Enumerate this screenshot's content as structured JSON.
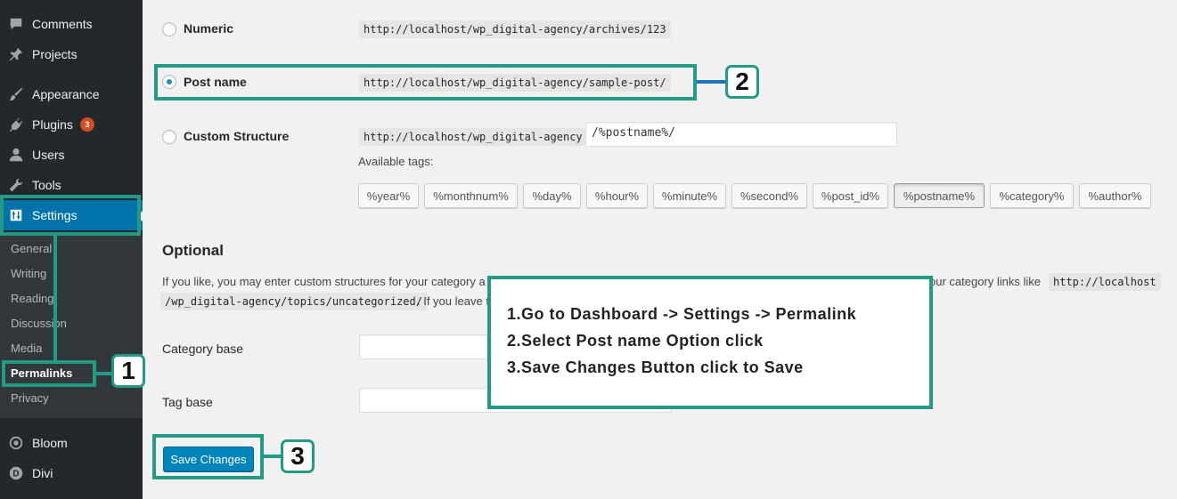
{
  "sidebar": {
    "menu": [
      {
        "label": "Comments",
        "icon": "comment-icon"
      },
      {
        "label": "Projects",
        "icon": "pin-icon"
      },
      {
        "label": "Appearance",
        "icon": "brush-icon"
      },
      {
        "label": "Plugins",
        "icon": "plugin-icon",
        "badge": "3"
      },
      {
        "label": "Users",
        "icon": "user-icon"
      },
      {
        "label": "Tools",
        "icon": "wrench-icon"
      },
      {
        "label": "Settings",
        "icon": "settings-icon"
      },
      {
        "label": "Bloom",
        "icon": "bloom-icon"
      },
      {
        "label": "Divi",
        "icon": "divi-icon"
      }
    ],
    "submenu": [
      "General",
      "Writing",
      "Reading",
      "Discussion",
      "Media",
      "Permalinks",
      "Privacy"
    ]
  },
  "permalink_options": {
    "numeric": {
      "label": "Numeric",
      "example": "http://localhost/wp_digital-agency/archives/123"
    },
    "post_name": {
      "label": "Post name",
      "example": "http://localhost/wp_digital-agency/sample-post/"
    },
    "custom": {
      "label": "Custom Structure",
      "prefix": "http://localhost/wp_digital-agency",
      "value": "/%postname%/"
    }
  },
  "available_tags_label": "Available tags:",
  "tags": [
    "%year%",
    "%monthnum%",
    "%day%",
    "%hour%",
    "%minute%",
    "%second%",
    "%post_id%",
    "%postname%",
    "%category%",
    "%author%"
  ],
  "optional": {
    "heading": "Optional",
    "line1_start": "If you like, you may enter custom structures for your category a",
    "line1_end": "our category links like",
    "line1_code": "http://localhost",
    "line2_code": "/wp_digital-agency/topics/uncategorized/",
    "line2_rest": ". If you leave t",
    "category_base_label": "Category base",
    "tag_base_label": "Tag base"
  },
  "save_button": "Save Changes",
  "annotations": {
    "numbers": [
      "1",
      "2",
      "3"
    ],
    "instructions": [
      "1.Go to Dashboard -> Settings -> Permalink",
      "2.Select Post name Option click",
      "3.Save Changes Button click to Save"
    ]
  },
  "colors": {
    "annotation": "#239a85",
    "accent": "#0073aa",
    "sidebar": "#23282d"
  }
}
